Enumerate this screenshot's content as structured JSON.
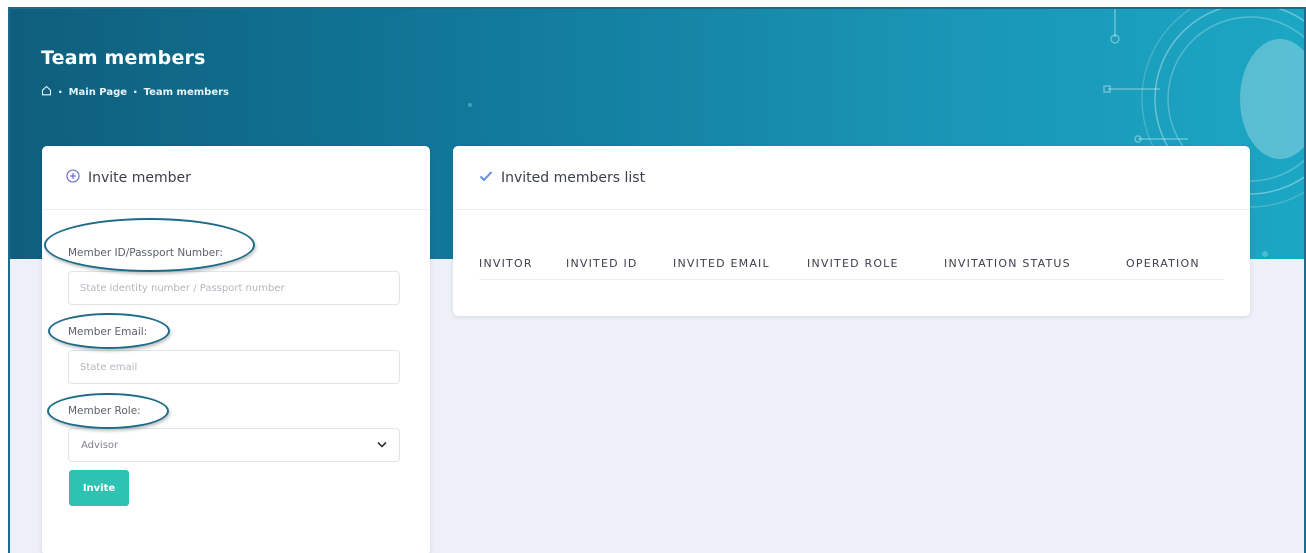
{
  "header": {
    "title": "Team members",
    "breadcrumb": {
      "home_icon": "home-icon",
      "items": [
        "Main Page",
        "Team members"
      ]
    }
  },
  "invite_card": {
    "icon": "plus-circle-icon",
    "title": "Invite member",
    "fields": {
      "member_id": {
        "label": "Member ID/Passport Number:",
        "placeholder": "State identity number / Passport number",
        "value": ""
      },
      "email": {
        "label": "Member Email:",
        "placeholder": "State email",
        "value": ""
      },
      "role": {
        "label": "Member Role:",
        "selected": "Advisor"
      }
    },
    "invite_button": "Invite"
  },
  "list_card": {
    "icon": "check-icon",
    "title": "Invited members list",
    "columns": [
      "INVITOR",
      "INVITED ID",
      "INVITED EMAIL",
      "INVITED ROLE",
      "INVITATION STATUS",
      "OPERATION"
    ],
    "rows": []
  },
  "colors": {
    "header_start": "#0f5e7c",
    "header_end": "#1ba7c4",
    "accent_button": "#2ec2b3",
    "annotation": "#1d6b88",
    "page_bg": "#eef0f7"
  }
}
